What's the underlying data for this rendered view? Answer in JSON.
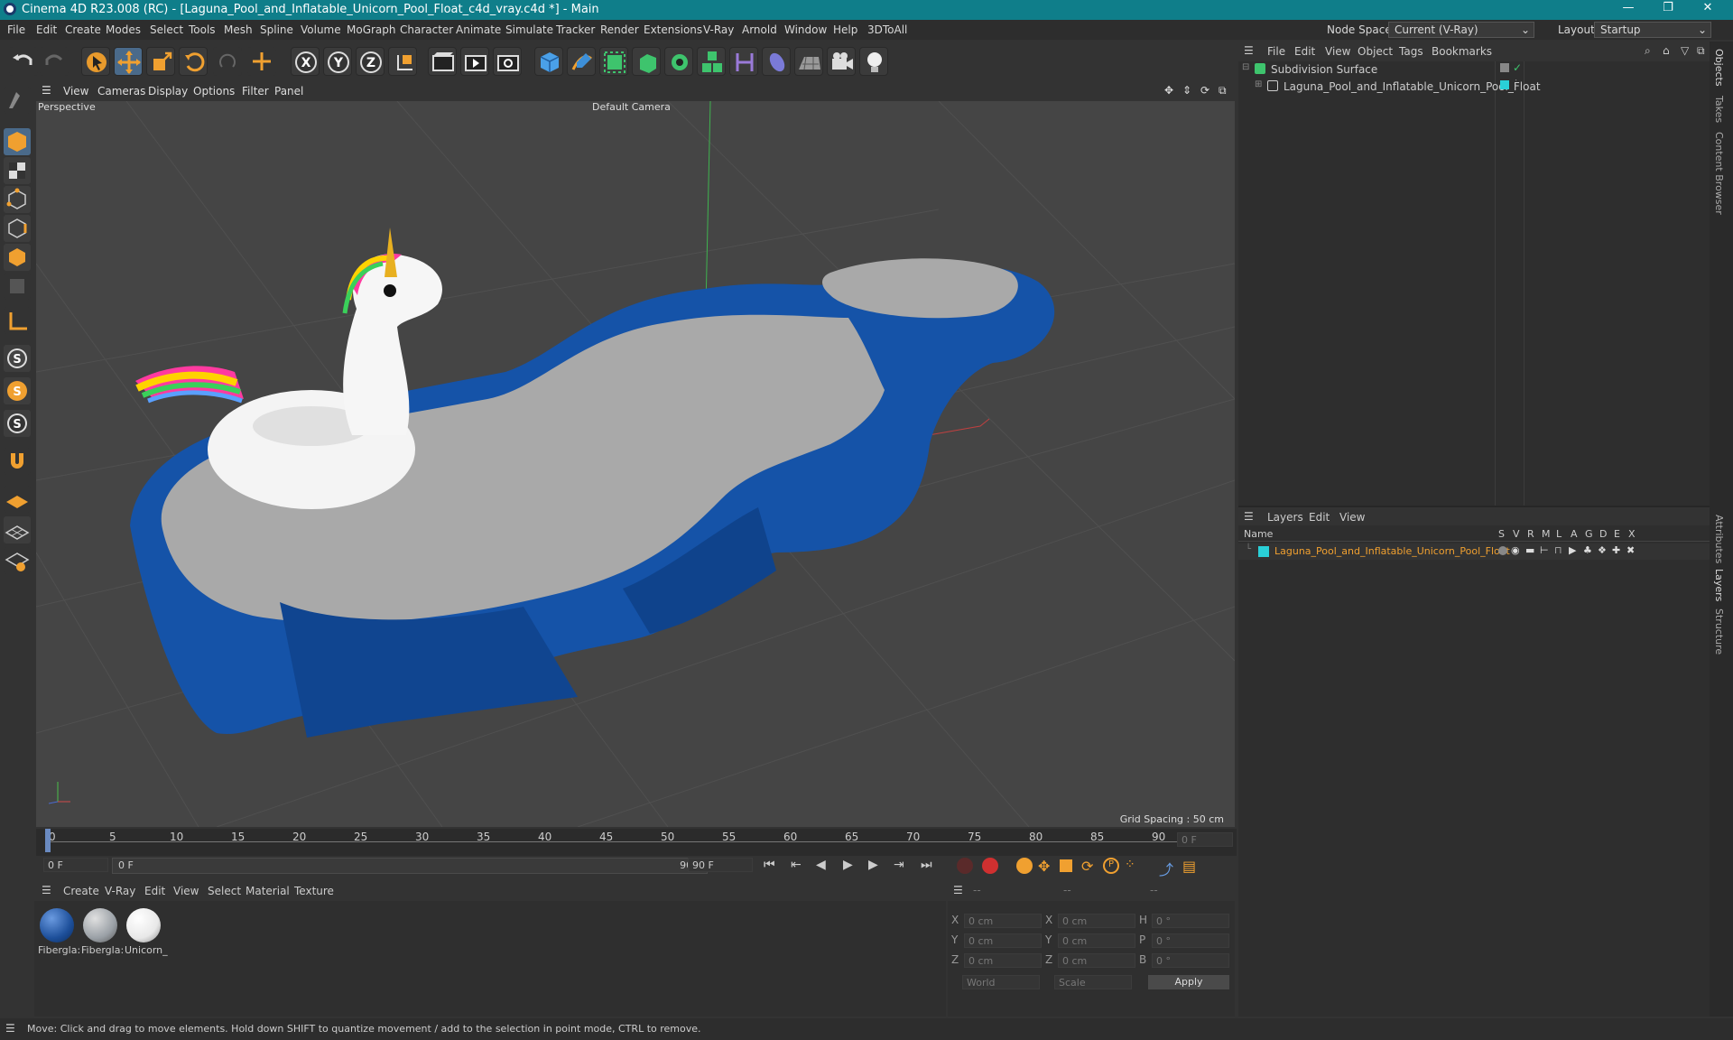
{
  "window": {
    "title": "Cinema 4D R23.008 (RC) - [Laguna_Pool_and_Inflatable_Unicorn_Pool_Float_c4d_vray.c4d *] - Main",
    "node_space_label": "Node Space:",
    "node_space_value": "Current (V-Ray)",
    "layout_label": "Layout:",
    "layout_value": "Startup"
  },
  "menu": [
    "File",
    "Edit",
    "Create",
    "Modes",
    "Select",
    "Tools",
    "Mesh",
    "Spline",
    "Volume",
    "MoGraph",
    "Character",
    "Animate",
    "Simulate",
    "Tracker",
    "Render",
    "Extensions",
    "V-Ray",
    "Arnold",
    "Window",
    "Help",
    "3DToAll"
  ],
  "viewport": {
    "menu": [
      "View",
      "Cameras",
      "Display",
      "Options",
      "Filter",
      "Panel"
    ],
    "view_name": "Perspective",
    "camera": "Default Camera",
    "grid_spacing": "Grid Spacing : 50 cm"
  },
  "timeline": {
    "ticks": [
      "0",
      "5",
      "10",
      "15",
      "20",
      "25",
      "30",
      "35",
      "40",
      "45",
      "50",
      "55",
      "60",
      "65",
      "70",
      "75",
      "80",
      "85",
      "90"
    ],
    "current_frame": "0 F",
    "start": "0 F",
    "range_start": "0 F",
    "range_end": "90 F",
    "end": "90 F"
  },
  "materials": {
    "menu": [
      "Create",
      "V-Ray",
      "Edit",
      "View",
      "Select",
      "Material",
      "Texture"
    ],
    "items": [
      {
        "label": "Fibergla:",
        "color": "#1d4f9a"
      },
      {
        "label": "Fibergla:",
        "color": "#9aa0a6"
      },
      {
        "label": "Unicorn_",
        "color": "#e8e8e8"
      }
    ]
  },
  "coords": {
    "headers": [
      "--",
      "--",
      "--"
    ],
    "rows": [
      {
        "a": "X",
        "av": "0 cm",
        "b": "X",
        "bv": "0 cm",
        "c": "H",
        "cv": "0 °"
      },
      {
        "a": "Y",
        "av": "0 cm",
        "b": "Y",
        "bv": "0 cm",
        "c": "P",
        "cv": "0 °"
      },
      {
        "a": "Z",
        "av": "0 cm",
        "b": "Z",
        "bv": "0 cm",
        "c": "B",
        "cv": "0 °"
      }
    ],
    "world": "World",
    "scale": "Scale",
    "apply": "Apply"
  },
  "objects": {
    "menu": [
      "File",
      "Edit",
      "View",
      "Object",
      "Tags",
      "Bookmarks"
    ],
    "items": [
      "Subdivision Surface",
      "Laguna_Pool_and_Inflatable_Unicorn_Pool_Float"
    ]
  },
  "layers": {
    "menu": [
      "Layers",
      "Edit",
      "View"
    ],
    "name_header": "Name",
    "cols": [
      "S",
      "V",
      "R",
      "M",
      "L",
      "A",
      "G",
      "D",
      "E",
      "X"
    ],
    "item": "Laguna_Pool_and_Inflatable_Unicorn_Pool_Float",
    "item_color": "#2ad0d8"
  },
  "sidetabs": [
    "Objects",
    "Takes",
    "Content Browser",
    "Attributes",
    "Layers",
    "Structure"
  ],
  "status": "Move: Click and drag to move elements. Hold down SHIFT to quantize movement / add to the selection in point mode, CTRL to remove.",
  "colors": {
    "accent": "#0f7e8a",
    "pool_blue": "#1553a8",
    "layer_orange": "#f0a030"
  }
}
